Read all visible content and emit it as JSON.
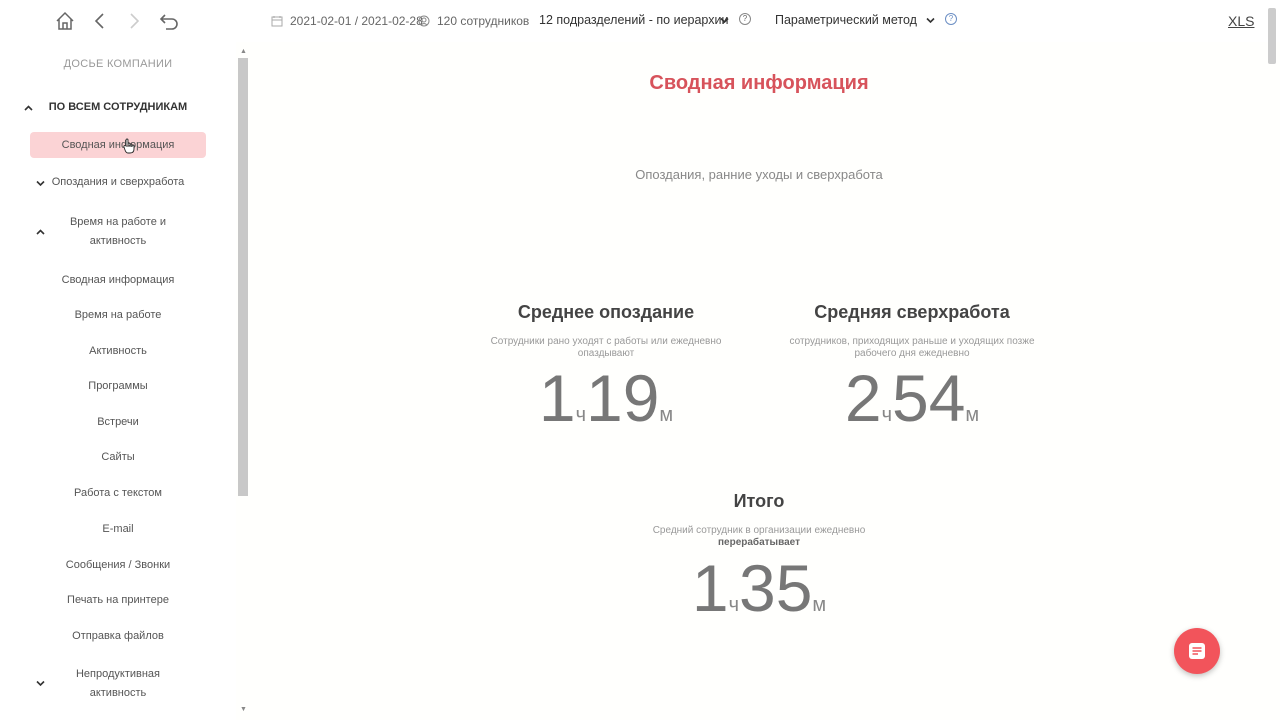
{
  "topbar": {
    "date_range": "2021-02-01 / 2021-02-28",
    "employees": "120 сотрудников",
    "departments": "12 подразделений - по иерархии",
    "method": "Параметрический метод",
    "xls": "XLS"
  },
  "sidebar": {
    "heading": "ДОСЬЕ КОМПАНИИ",
    "section_all": "ПО ВСЕМ СОТРУДНИКАМ",
    "active_item": "Сводная информация",
    "late_item": "Опоздания и сверхработа",
    "time_group": "Время на работе и активность",
    "sub_items": [
      "Сводная информация",
      "Время на работе",
      "Активность",
      "Программы",
      "Встречи",
      "Сайты",
      "Работа с текстом",
      "E-mail",
      "Сообщения / Звонки",
      "Печать на принтере",
      "Отправка файлов"
    ],
    "unproductive": "Непродуктивная активность"
  },
  "main": {
    "title": "Сводная информация",
    "subtitle": "Опоздания, ранние уходы и сверхработа",
    "late": {
      "title": "Среднее опоздание",
      "desc": "Сотрудники рано уходят с работы или ежедневно опаздывают",
      "hours": "1",
      "h_unit": "ч",
      "minutes": "19",
      "m_unit": "м"
    },
    "overtime": {
      "title": "Средняя сверхработа",
      "desc": "сотрудников, приходящих раньше и уходящих позже рабочего дня ежедневно",
      "hours": "2",
      "h_unit": "ч",
      "minutes": "54",
      "m_unit": "м"
    },
    "total": {
      "title": "Итого",
      "desc": "Средний сотрудник в организации ежедневно",
      "desc_bold": "перерабатывает",
      "hours": "1",
      "h_unit": "ч",
      "minutes": "35",
      "m_unit": "м"
    }
  },
  "colors": {
    "accent": "#d7535b",
    "fab": "#f2545b",
    "active_bg": "#fbd3d5"
  }
}
